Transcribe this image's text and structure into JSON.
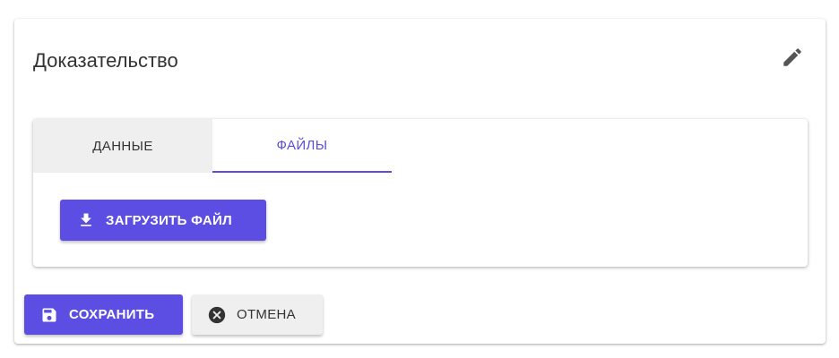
{
  "card": {
    "title": "Доказательство",
    "edit_icon": "pencil-icon"
  },
  "tabs": [
    {
      "label": "ДАННЫЕ",
      "active": false
    },
    {
      "label": "ФАЙЛЫ",
      "active": true
    }
  ],
  "files_tab": {
    "upload_label": "ЗАГРУЗИТЬ ФАЙЛ",
    "upload_icon": "download-icon"
  },
  "actions": {
    "save_label": "СОХРАНИТЬ",
    "save_icon": "floppy-disk-icon",
    "cancel_label": "ОТМЕНА",
    "cancel_icon": "close-circle-icon"
  },
  "colors": {
    "accent": "#5c4ee2",
    "tab_active_text": "#5a4ed8",
    "tab_inactive_bg": "#efefef",
    "text": "#333333"
  }
}
